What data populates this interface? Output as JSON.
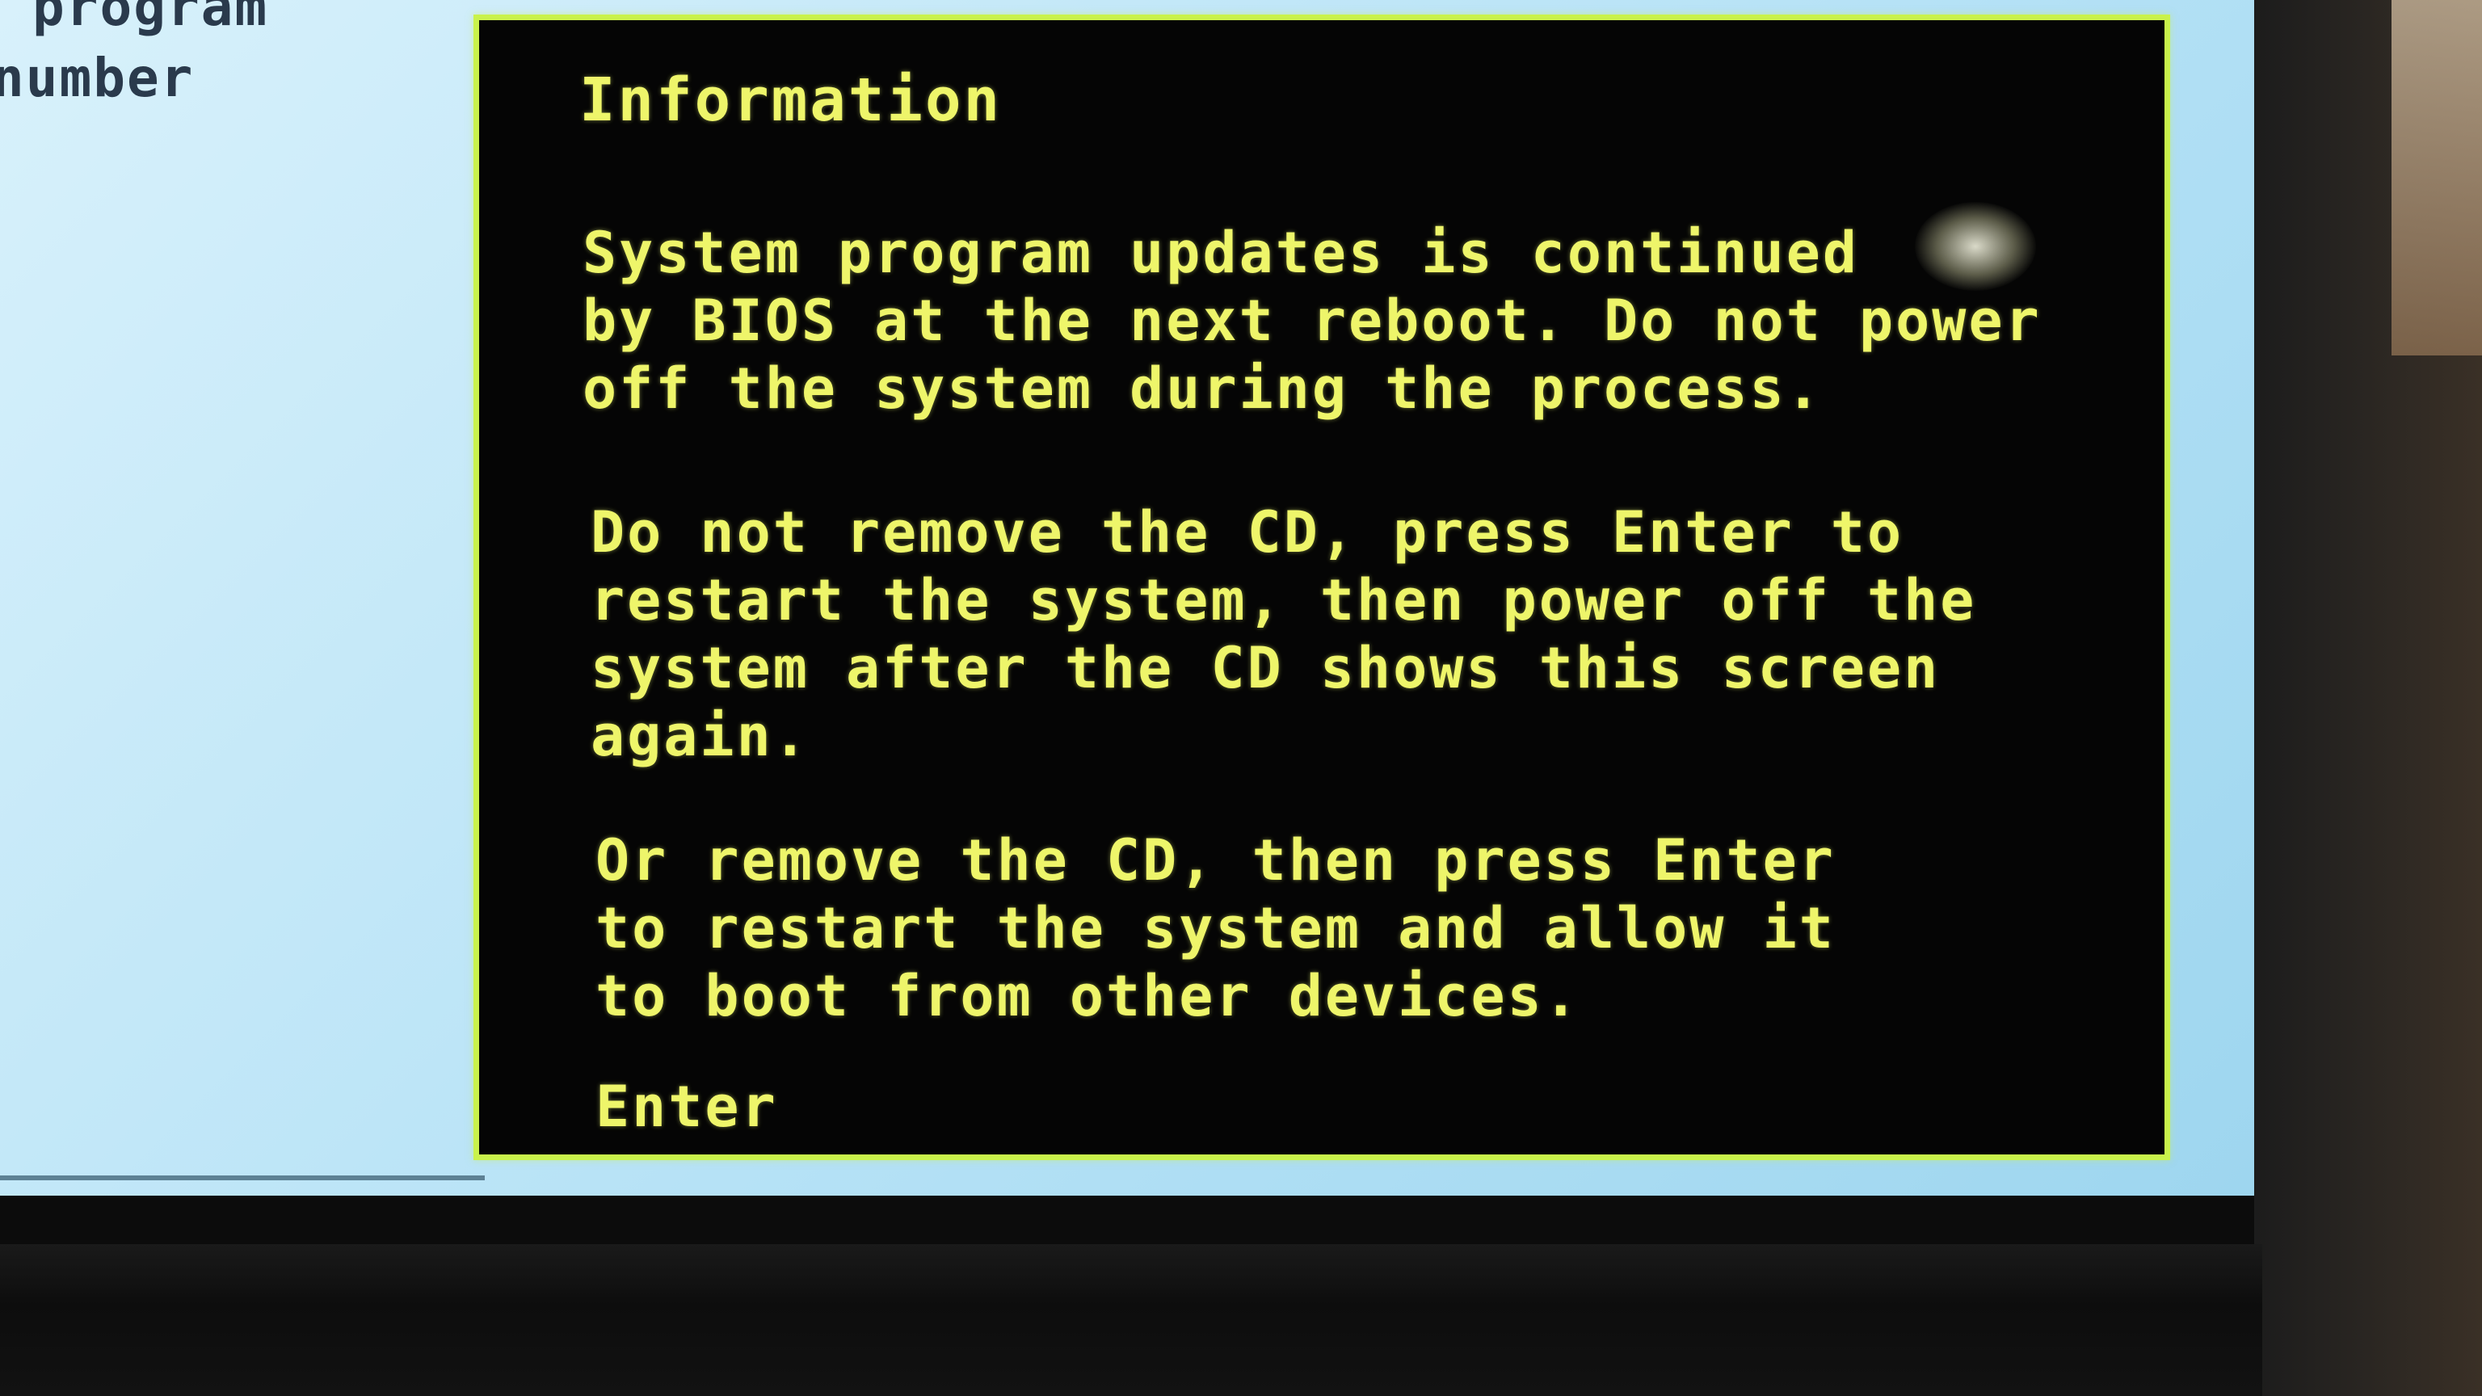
{
  "background": {
    "lines": [
      "program",
      "number"
    ]
  },
  "dialog": {
    "title": "Information",
    "paragraphs": [
      {
        "lines": [
          "System program updates is continued",
          "by BIOS at the next reboot. Do not power",
          "off the system during the process."
        ]
      },
      {
        "lines": [
          "Do not remove the CD, press Enter to",
          "restart the system, then power off the",
          "system after the CD shows this screen",
          "again."
        ]
      },
      {
        "lines": [
          "Or remove the CD, then press Enter",
          "to restart the system and allow it",
          "to boot from other devices."
        ]
      }
    ],
    "button_label": "Enter"
  },
  "colors": {
    "dialog_border": "#c9f24b",
    "dialog_text": "#eef56a",
    "dialog_bg": "#050505",
    "background_panel": "#b6e2f6"
  }
}
